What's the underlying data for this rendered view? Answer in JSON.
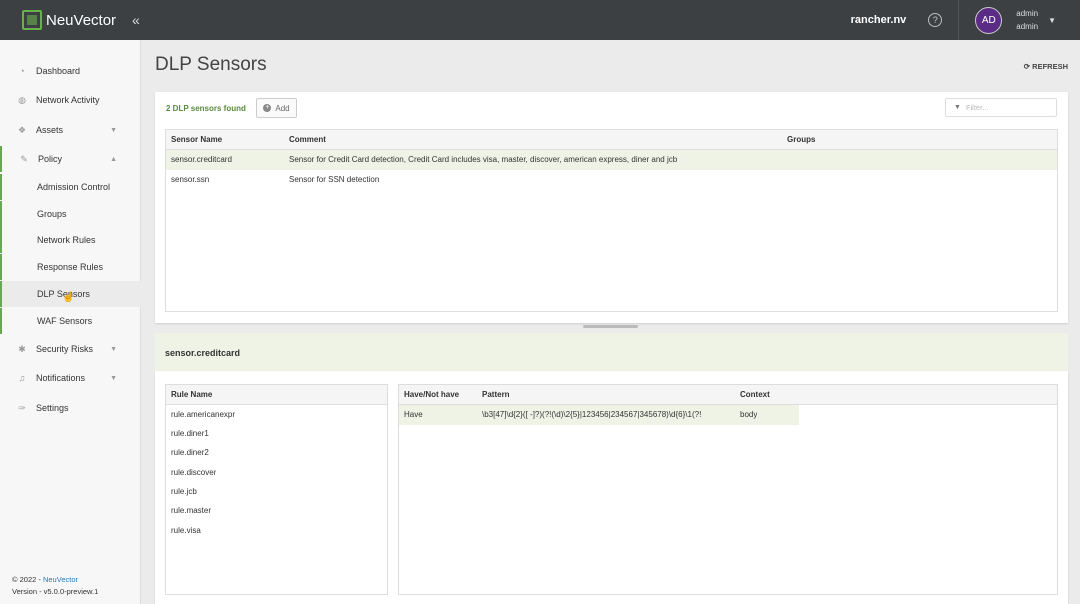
{
  "header": {
    "brand": "NeuVector",
    "collapse_glyph": "«",
    "cluster": "rancher.nv",
    "help_glyph": "?",
    "avatar_initials": "AD",
    "user_name": "admin",
    "user_role": "admin"
  },
  "sidebar": {
    "items": [
      {
        "label": "Dashboard",
        "icon": "dashboard-icon"
      },
      {
        "label": "Network Activity",
        "icon": "globe-icon"
      },
      {
        "label": "Assets",
        "icon": "assets-icon"
      },
      {
        "label": "Policy",
        "icon": "policy-icon"
      },
      {
        "label": "Security Risks",
        "icon": "gear-icon"
      },
      {
        "label": "Notifications",
        "icon": "bell-icon"
      },
      {
        "label": "Settings",
        "icon": "wrench-icon"
      }
    ],
    "policy_subitems": [
      "Admission Control",
      "Groups",
      "Network Rules",
      "Response Rules",
      "DLP Sensors",
      "WAF Sensors"
    ],
    "footer_copyright": "© 2022 - ",
    "footer_brand": "NeuVector",
    "footer_version": "Version - v5.0.0-preview.1"
  },
  "page": {
    "title": "DLP Sensors",
    "refresh_label": "REFRESH",
    "found_text": "2 DLP sensors found",
    "add_label": "Add",
    "filter_placeholder": "Filter..."
  },
  "sensors_table": {
    "columns": [
      "Sensor Name",
      "Comment",
      "Groups"
    ],
    "rows": [
      {
        "name": "sensor.creditcard",
        "comment": "Sensor for Credit Card detection, Credit Card includes visa, master, discover, american express, diner and jcb",
        "groups": ""
      },
      {
        "name": "sensor.ssn",
        "comment": "Sensor for SSN detection",
        "groups": ""
      }
    ]
  },
  "detail": {
    "title": "sensor.creditcard",
    "rules_column": "Rule Name",
    "rules": [
      "rule.americanexpr",
      "rule.diner1",
      "rule.diner2",
      "rule.discover",
      "rule.jcb",
      "rule.master",
      "rule.visa"
    ],
    "pattern_columns": [
      "Have/Not have",
      "Pattern",
      "Context"
    ],
    "pattern_rows": [
      {
        "have": "Have",
        "pattern": "\\b3[47]\\d{2}([ -]?)(?!(\\d)\\2{5}|123456|234567|345678)\\d{6}\\1(?!",
        "context": "body"
      }
    ]
  }
}
